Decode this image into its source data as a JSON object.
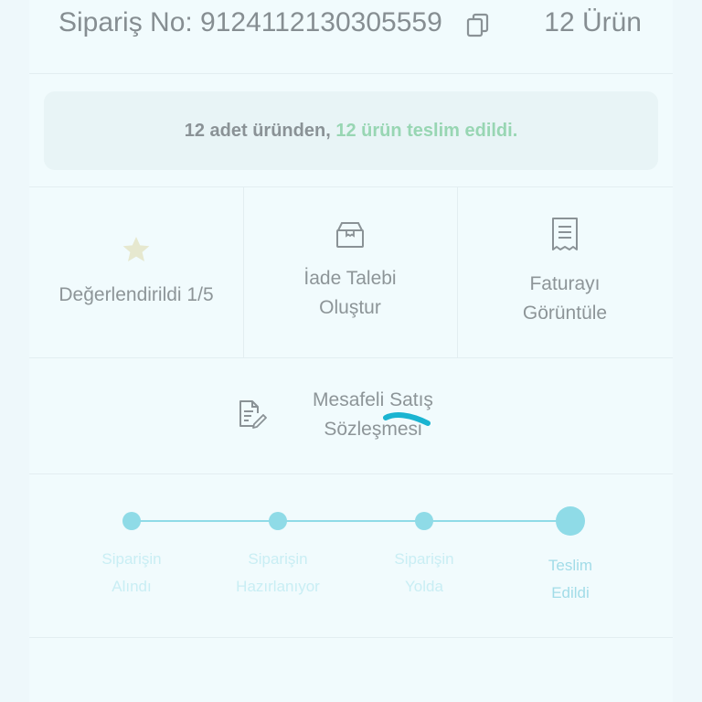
{
  "header": {
    "order_label": "Sipariş No: 9124112130305559",
    "item_count": "12 Ürün"
  },
  "banner": {
    "prefix": "12 adet üründen, ",
    "highlight": "12 ürün teslim edildi."
  },
  "actions": [
    {
      "label": "Değerlendirildi 1/5",
      "icon": "star-icon"
    },
    {
      "label_line1": "İade Talebi",
      "label_line2": "Oluştur",
      "icon": "return-box-icon"
    },
    {
      "label_line1": "Faturayı",
      "label_line2": "Görüntüle",
      "icon": "invoice-icon"
    }
  ],
  "contract": {
    "label_line1": "Mesafeli Satış",
    "label_line2": "Sözleşmesi",
    "icon": "document-edit-icon"
  },
  "tracking": {
    "steps": [
      {
        "line1": "Siparişin",
        "line2": "Alındı"
      },
      {
        "line1": "Siparişin",
        "line2": "Hazırlanıyor"
      },
      {
        "line1": "Siparişin",
        "line2": "Yolda"
      },
      {
        "line1": "Teslim",
        "line2": "Edildi"
      }
    ],
    "current_step": 4,
    "accent_color": "#8fdbe7"
  },
  "colors": {
    "delivered_text": "#98d6b3",
    "star": "#e9e9c8"
  }
}
